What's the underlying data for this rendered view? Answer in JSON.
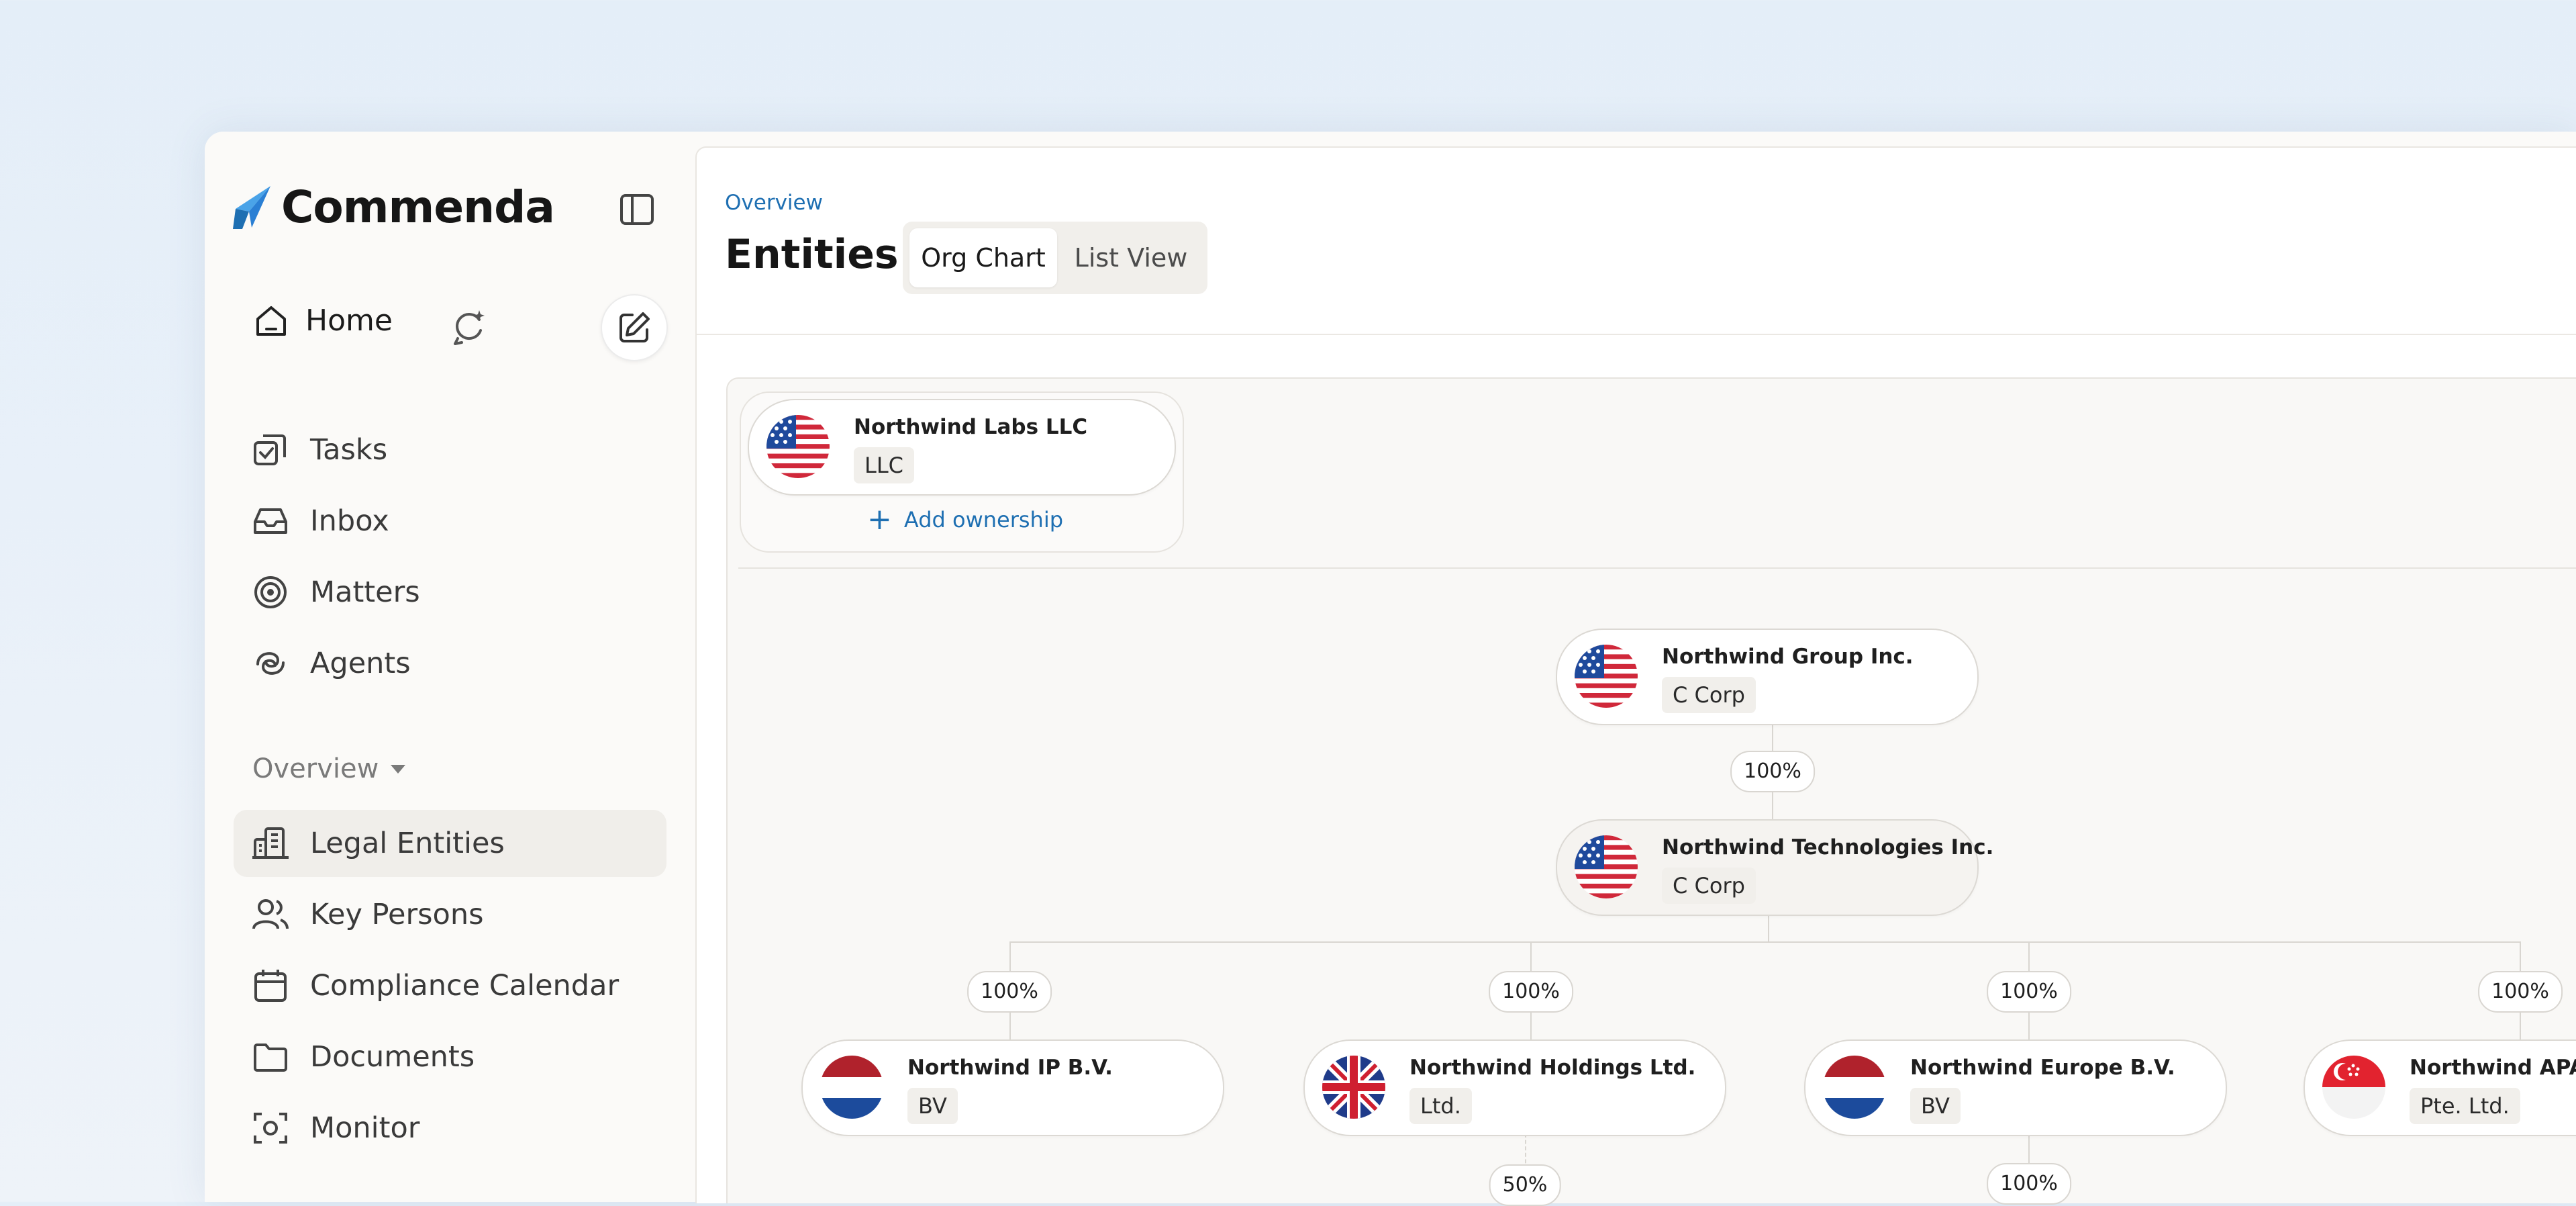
{
  "app": {
    "name": "Commenda",
    "brand_color": "#2a7fd4",
    "accent_link": "#1e6fb2"
  },
  "sidebar": {
    "home_label": "Home",
    "primary": [
      {
        "label": "Tasks",
        "icon": "tasks-icon"
      },
      {
        "label": "Inbox",
        "icon": "inbox-icon"
      },
      {
        "label": "Matters",
        "icon": "target-icon"
      },
      {
        "label": "Agents",
        "icon": "agents-icon"
      }
    ],
    "section_label": "Overview",
    "section_items": [
      {
        "label": "Legal Entities",
        "icon": "building-icon",
        "active": true
      },
      {
        "label": "Key Persons",
        "icon": "users-icon"
      },
      {
        "label": "Compliance Calendar",
        "icon": "calendar-icon"
      },
      {
        "label": "Documents",
        "icon": "folder-icon"
      },
      {
        "label": "Monitor",
        "icon": "monitor-icon"
      }
    ]
  },
  "header": {
    "breadcrumb": "Overview",
    "title": "Entities",
    "tabs": [
      {
        "label": "Org Chart",
        "active": true
      },
      {
        "label": "List View",
        "active": false
      }
    ]
  },
  "org_chart": {
    "unowned": {
      "name": "Northwind Labs LLC",
      "type": "LLC",
      "flag": "us",
      "add_label": "Add ownership"
    },
    "root": {
      "name": "Northwind Group Inc.",
      "type": "C Corp",
      "flag": "us"
    },
    "root_to_child_pct": "100%",
    "parent": {
      "name": "Northwind Technologies Inc.",
      "type": "C Corp",
      "flag": "us"
    },
    "subsidiaries": [
      {
        "name": "Northwind IP B.V.",
        "type": "BV",
        "flag": "nl",
        "pct": "100%"
      },
      {
        "name": "Northwind Holdings Ltd.",
        "type": "Ltd.",
        "flag": "gb",
        "pct": "100%",
        "child_pct": "50%"
      },
      {
        "name": "Northwind Europe B.V.",
        "type": "BV",
        "flag": "nl",
        "pct": "100%",
        "child_pct": "100%"
      },
      {
        "name": "Northwind APAC",
        "type": "Pte. Ltd.",
        "flag": "sg",
        "pct": "100%"
      }
    ]
  }
}
